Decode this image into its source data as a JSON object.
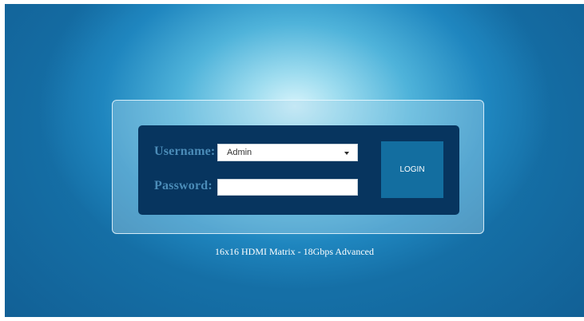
{
  "login": {
    "username_label": "Username:",
    "username_value": "Admin",
    "password_label": "Password:",
    "password_value": "",
    "login_button_label": "LOGIN"
  },
  "footer": {
    "product_title": "16x16 HDMI Matrix - 18Gbps Advanced"
  },
  "colors": {
    "panel": "#07355f",
    "label": "#4b8cb8",
    "button": "#136ea0",
    "background": "#1f86bf"
  },
  "icons": {
    "dropdown": "chevron-down-icon"
  }
}
